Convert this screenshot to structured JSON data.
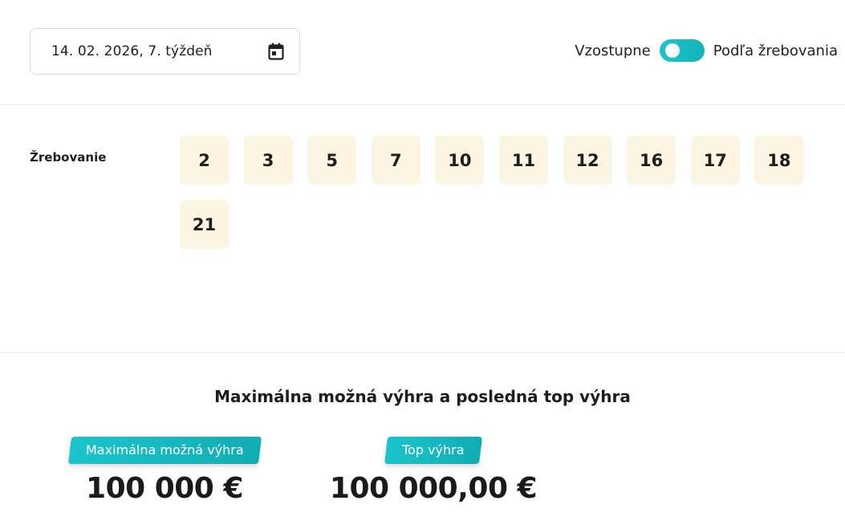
{
  "date_picker": {
    "value": "14. 02. 2026, 7. týždeň",
    "icon": "calendar-icon"
  },
  "sort": {
    "label_left": "Vzostupne",
    "label_right": "Podľa žrebovania",
    "toggle_on": true,
    "accent_color": "#1bc4cc"
  },
  "draw": {
    "label": "Žrebovanie",
    "numbers": [
      "2",
      "3",
      "5",
      "7",
      "10",
      "11",
      "12",
      "16",
      "17",
      "18",
      "21"
    ],
    "ball_color": "#fdf4e2"
  },
  "prizes": {
    "title": "Maximálna možná výhra a posledná top výhra",
    "max": {
      "tag": "Maximálna možná výhra",
      "value": "100 000 €"
    },
    "top": {
      "tag": "Top výhra",
      "value": "100 000,00 €"
    }
  }
}
